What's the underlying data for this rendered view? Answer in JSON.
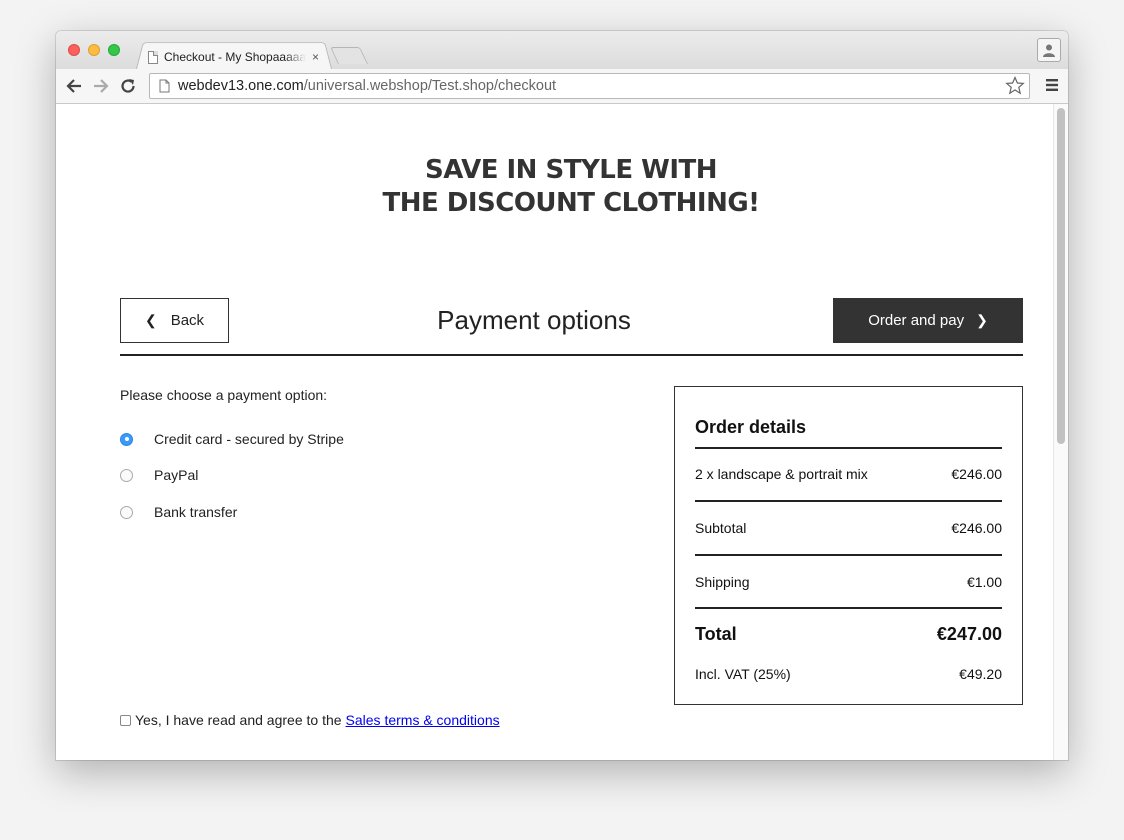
{
  "browser": {
    "tab_title": "Checkout - My Shopaaaaaaaa",
    "tab_close": "×",
    "url_host": "webdev13.one.com",
    "url_path": "/universal.webshop/Test.shop/checkout"
  },
  "page": {
    "headline_line1": "SAVE IN STYLE WITH",
    "headline_line2": "THE DISCOUNT CLOTHING!",
    "back_label": "Back",
    "title": "Payment options",
    "order_label": "Order and pay",
    "prompt": "Please choose a payment option:",
    "payment_options": [
      {
        "label": "Credit card - secured by Stripe",
        "selected": true
      },
      {
        "label": "PayPal",
        "selected": false
      },
      {
        "label": "Bank transfer",
        "selected": false
      }
    ],
    "terms_text": "Yes, I have read and agree to the",
    "terms_link": "Sales terms & conditions",
    "terms_checked": false
  },
  "order": {
    "title": "Order details",
    "item_label": "2 x landscape & portrait mix",
    "item_price": "€246.00",
    "subtotal_label": "Subtotal",
    "subtotal_value": "€246.00",
    "shipping_label": "Shipping",
    "shipping_value": "€1.00",
    "total_label": "Total",
    "total_value": "€247.00",
    "vat_label": "Incl. VAT (25%)",
    "vat_value": "€49.20"
  },
  "colors": {
    "primary_button": "#333333",
    "radio_selected": "#3b99fc",
    "link": "#0000ee"
  }
}
